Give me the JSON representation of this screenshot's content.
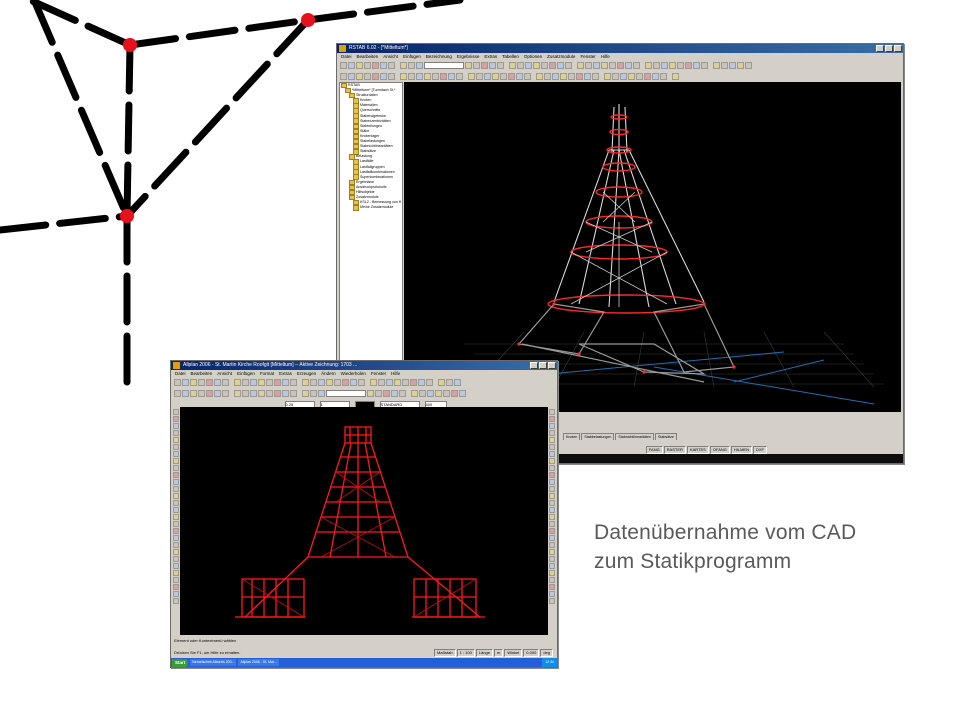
{
  "caption": {
    "line1": "Datenübernahme vom CAD",
    "line2": "zum Statikprogramm"
  },
  "colors": {
    "network_line": "#000000",
    "network_node": "#e8111b",
    "caption_text": "#595959",
    "tower_red": "#ff1a1a",
    "viewport_bg": "#000000"
  },
  "rstab_window": {
    "title": "RSTAB 6.02 - [*Mitteltum*]",
    "menu": [
      "Datei",
      "Bearbeiten",
      "Ansicht",
      "Einfügen",
      "Bezeichnung",
      "Ergebnisse",
      "Extras",
      "Tabellen",
      "Optionen",
      "Zusatzmodule",
      "Fenster",
      "Hilfe"
    ],
    "tree": [
      "RSTAB",
      "*Mittelturm* [Turmdach St.*",
      "Strukturdaten",
      "Knoten",
      "Materialien",
      "Querschnitte",
      "Stabendgelenke",
      "Stabexzentrizitäten",
      "Stabteilungen",
      "Stäbe",
      "Knotenlager",
      "Stabelastungen",
      "Stabnichtlinearitäten",
      "Stabsätze",
      "Belastung",
      "Lastfälle",
      "Lastfallgruppen",
      "Lastfallkombinationen",
      "Superkombinationen",
      "Ergebnisse",
      "Ausdruckprotokolle",
      "Hilfsobjekte",
      "Zusatzmodule",
      "KSL2 - Bemessung von H",
      "Meine Zusatzmodule"
    ],
    "tabs": [
      "Knoten",
      "Stabbelastungen",
      "Stabnichtlinearitäten",
      "Stabsätze"
    ],
    "status": [
      "FANG",
      "RASTER",
      "KARTES",
      "OFANG",
      "HILMEN",
      "DXF"
    ]
  },
  "cad_window": {
    "title": "Allplan 2006 - St. Martin Kirche Roofgit  [Mitteltum]  -- Aktive Zeichnung: 1703 ...",
    "menu": [
      "Datei",
      "Bearbeiten",
      "Ansicht",
      "Einfügen",
      "Format",
      "Extras",
      "Erzeugen",
      "Ändern",
      "Wiederholen",
      "Fenster",
      "Hilfe"
    ],
    "prompt": "Element oder Kontextmenü wählen",
    "status_left": "Drücken Sie F1, um Hilfe zu erhalten.",
    "status_fields": [
      "Maßstab",
      "1 : 100",
      "Länge",
      "m",
      "Winkel",
      "0.000",
      "deg"
    ],
    "fields": [
      "0.25",
      "1",
      "STANDARD",
      "400"
    ],
    "start_label": "Start",
    "task_items": [
      "Nemetschek Allwerts 200...",
      "Allplan 2006 - St. Mar..."
    ],
    "clock": "12:34"
  }
}
